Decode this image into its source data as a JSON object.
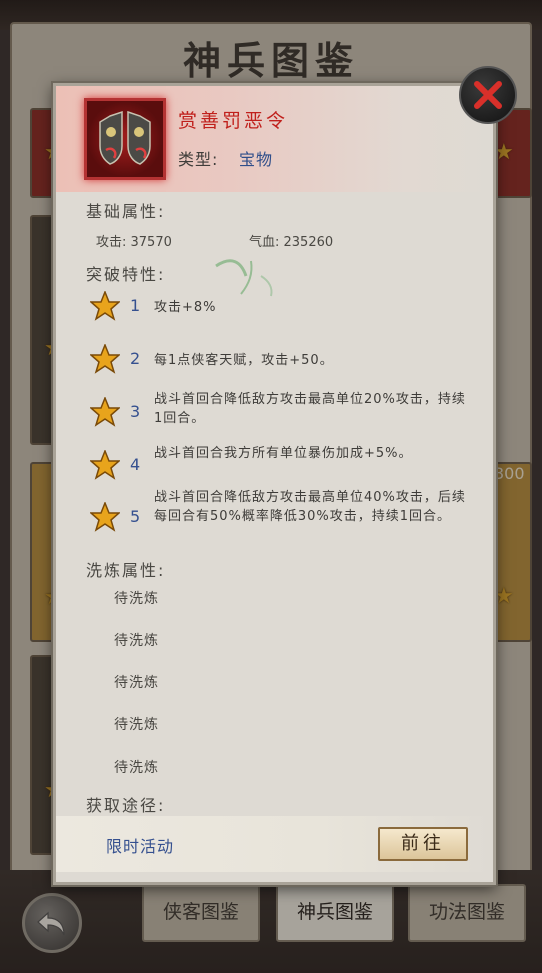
{
  "background": {
    "title": "神兵图鉴",
    "bg_numbers": [
      "300"
    ],
    "tabs": [
      {
        "label": "侠客图鉴",
        "active": false
      },
      {
        "label": "神兵图鉴",
        "active": true
      },
      {
        "label": "功法图鉴",
        "active": false
      }
    ]
  },
  "item": {
    "name": "赏善罚恶令",
    "type_label": "类型:",
    "type_value": "宝物"
  },
  "base": {
    "title": "基础属性:",
    "attack": "攻击: 37570",
    "hp": "气血: 235260"
  },
  "breakthrough": {
    "title": "突破特性:",
    "rows": [
      {
        "num": "1",
        "text": "攻击+8%"
      },
      {
        "num": "2",
        "text": "每1点侠客天赋，攻击+50。"
      },
      {
        "num": "3",
        "text": "战斗首回合降低敌方攻击最高单位20%攻击，持续1回合。"
      },
      {
        "num": "4",
        "text": "战斗首回合我方所有单位暴伤加成+5%。"
      },
      {
        "num": "5",
        "text": "战斗首回合降低敌方攻击最高单位40%攻击，后续每回合有50%概率降低30%攻击，持续1回合。"
      }
    ]
  },
  "refine": {
    "title": "洗炼属性:",
    "slots": [
      "待洗炼",
      "待洗炼",
      "待洗炼",
      "待洗炼",
      "待洗炼"
    ]
  },
  "acquire": {
    "title": "获取途径:",
    "source": "限时活动",
    "goto_label": "前往"
  },
  "colors": {
    "item_name": "#c0201c",
    "link_blue": "#35508f",
    "star_gold": "#e8a41c"
  },
  "icons": [
    "close-icon",
    "star-icon",
    "back-arrow-icon",
    "item-artifact-icon"
  ]
}
